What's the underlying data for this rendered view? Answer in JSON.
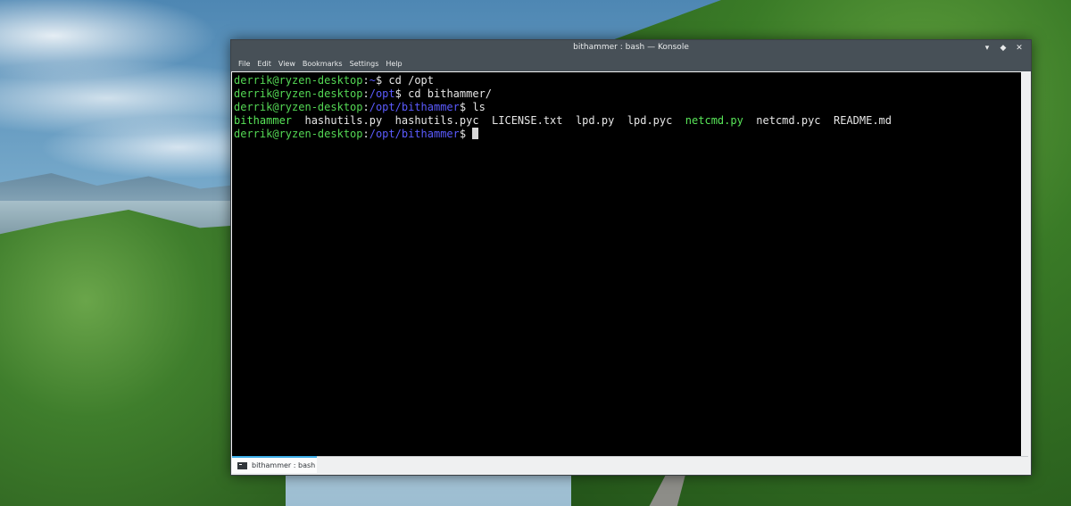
{
  "window": {
    "title": "bithammer : bash — Konsole",
    "minimize_glyph": "▾",
    "maximize_glyph": "◆",
    "close_glyph": "✕"
  },
  "menu": [
    "File",
    "Edit",
    "View",
    "Bookmarks",
    "Settings",
    "Help"
  ],
  "terminal": {
    "lines": [
      {
        "user": "derrik@ryzen-desktop",
        "sep": ":",
        "path": "~",
        "dollar": "$ ",
        "cmd": "cd /opt"
      },
      {
        "user": "derrik@ryzen-desktop",
        "sep": ":",
        "path": "/opt",
        "dollar": "$ ",
        "cmd": "cd bithammer/"
      },
      {
        "user": "derrik@ryzen-desktop",
        "sep": ":",
        "path": "/opt/bithammer",
        "dollar": "$ ",
        "cmd": "ls"
      }
    ],
    "ls_output": [
      {
        "name": "bithammer",
        "kind": "exec"
      },
      {
        "name": "hashutils.py",
        "kind": "file"
      },
      {
        "name": "hashutils.pyc",
        "kind": "file"
      },
      {
        "name": "LICENSE.txt",
        "kind": "file"
      },
      {
        "name": "lpd.py",
        "kind": "file"
      },
      {
        "name": "lpd.pyc",
        "kind": "file"
      },
      {
        "name": "netcmd.py",
        "kind": "exec"
      },
      {
        "name": "netcmd.pyc",
        "kind": "file"
      },
      {
        "name": "README.md",
        "kind": "file"
      }
    ],
    "prompt": {
      "user": "derrik@ryzen-desktop",
      "sep": ":",
      "path": "/opt/bithammer",
      "dollar": "$ "
    },
    "colors": {
      "user": "#54d754",
      "path": "#5b5bff",
      "exec": "#58e558",
      "text": "#e6e6e6"
    }
  },
  "tab": {
    "label": "bithammer : bash",
    "icon": "terminal-icon"
  }
}
